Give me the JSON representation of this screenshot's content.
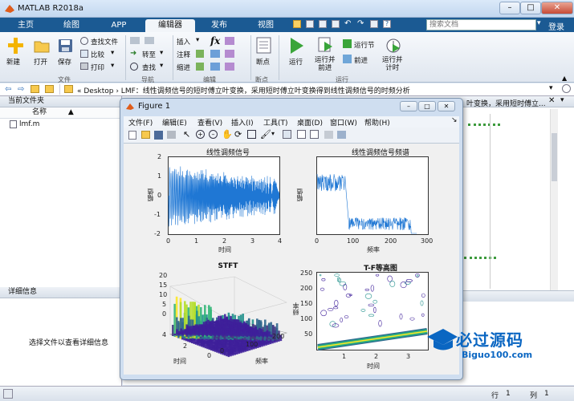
{
  "app": {
    "title": "MATLAB R2018a"
  },
  "tabs": [
    "主页",
    "绘图",
    "APP",
    "编辑器",
    "发布",
    "视图"
  ],
  "search": {
    "placeholder": "搜索文档"
  },
  "login": "登录",
  "toolstrip": {
    "file": {
      "new": "新建",
      "open": "打开",
      "save": "保存",
      "find_files": "查找文件",
      "compare": "比较",
      "print": "打印",
      "label": "文件"
    },
    "nav": {
      "goto": "转至",
      "find": "查找",
      "label": "导航"
    },
    "edit": {
      "insert": "插入",
      "comment": "注释",
      "indent": "缩进",
      "fx": "fx",
      "label": "编辑"
    },
    "breakpoints": {
      "breakpoint": "断点",
      "label": "断点"
    },
    "run": {
      "run": "运行",
      "run_advance": "运行并\n前进",
      "run_section": "运行节",
      "advance": "前进",
      "run_time": "运行并\n计时",
      "label": "运行"
    }
  },
  "address": {
    "path": "«  Desktop  ›  LMF：线性调频信号的短时傅立叶变换，采用短时傅立叶变换得到线性调频信号的时频分析"
  },
  "left_panel": {
    "header": "当前文件夹",
    "col_name": "名称",
    "file": "lmf.m",
    "details_header": "详细信息",
    "details_hint": "选择文件以查看详细信息"
  },
  "cmd_area": {
    "snippet": "叶变换，采用短时傅立..."
  },
  "status": {
    "row_label": "行",
    "row_value": "1",
    "col_label": "列",
    "col_value": "1"
  },
  "figure": {
    "title": "Figure 1",
    "menus": [
      "文件(F)",
      "编辑(E)",
      "查看(V)",
      "插入(I)",
      "工具(T)",
      "桌面(D)",
      "窗口(W)",
      "帮助(H)"
    ],
    "plots": {
      "p1": {
        "title": "线性调频信号",
        "xlabel": "时间",
        "ylabel": "幅值",
        "xticks": [
          "0",
          "1",
          "2",
          "3",
          "4"
        ],
        "yticks": [
          "2",
          "1",
          "0",
          "-1",
          "-2"
        ]
      },
      "p2": {
        "title": "线性调频信号频谱",
        "xlabel": "频率",
        "ylabel": "幅值",
        "xticks": [
          "0",
          "100",
          "200",
          "300"
        ]
      },
      "p3": {
        "title": "STFT",
        "xlabel": "频率",
        "ylabel": "时间",
        "zticks": [
          "20",
          "15",
          "10",
          "5",
          "0"
        ],
        "yticks": [
          "4",
          "2",
          "0"
        ],
        "xticks": [
          "0",
          "100",
          "200"
        ]
      },
      "p4": {
        "title": "T-F等高图",
        "xlabel": "时间",
        "ylabel": "频率",
        "yticks": [
          "250",
          "200",
          "150",
          "100",
          "50"
        ],
        "xticks": [
          "1",
          "2",
          "3"
        ]
      }
    }
  },
  "watermark": {
    "text": "必过源码",
    "url": "Biguo100.com"
  }
}
